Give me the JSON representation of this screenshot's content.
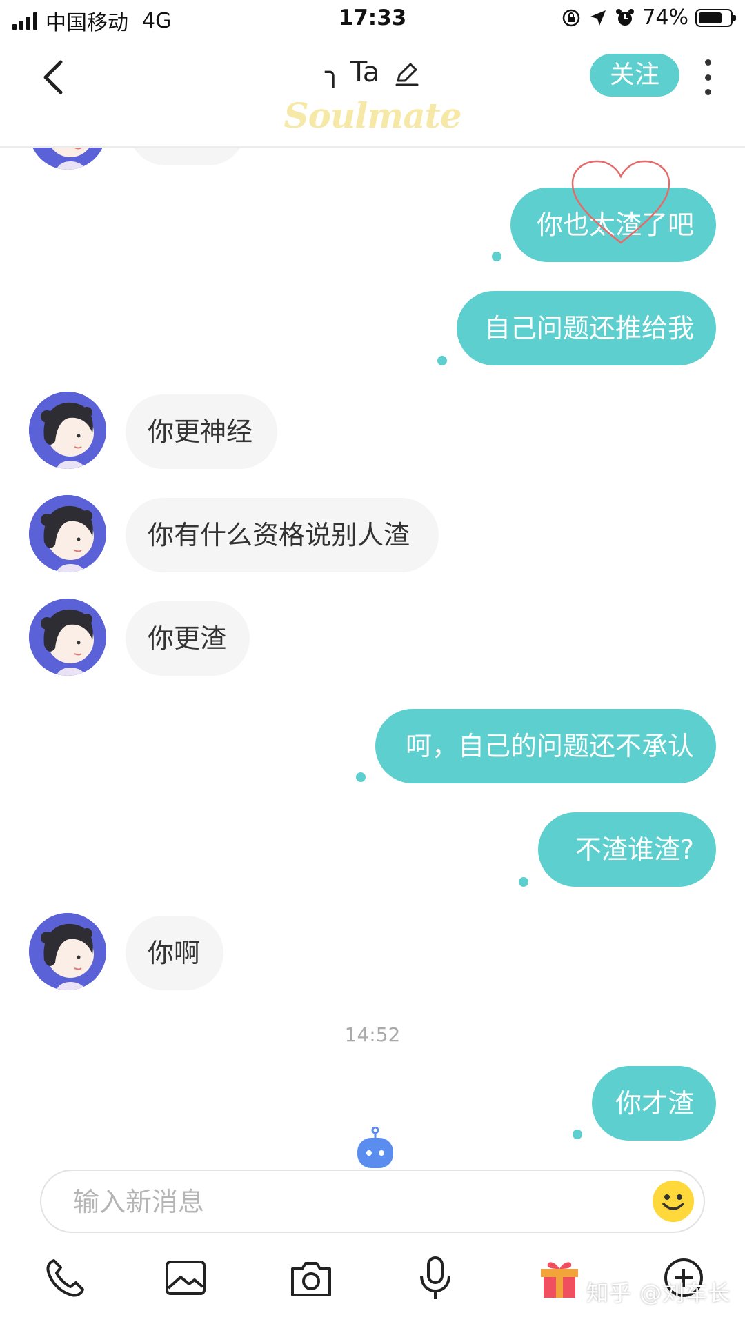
{
  "status_bar": {
    "carrier": "中国移动",
    "network": "4G",
    "time": "17:33",
    "battery_text": "74%",
    "battery_level": 0.74
  },
  "nav": {
    "title": "╮ Ta",
    "brand": "Soulmate",
    "follow_label": "关注"
  },
  "messages": [
    {
      "side": "sent",
      "text": "你也太渣了吧"
    },
    {
      "side": "sent",
      "text": "自己问题还推给我"
    },
    {
      "side": "received",
      "text": "你更神经"
    },
    {
      "side": "received",
      "text": "你有什么资格说别人渣"
    },
    {
      "side": "received",
      "text": "你更渣"
    },
    {
      "side": "sent",
      "text": "呵，自己的问题还不承认"
    },
    {
      "side": "sent",
      "text": "不渣谁渣?"
    },
    {
      "side": "received",
      "text": "你啊"
    },
    {
      "side": "sent",
      "text": "你才渣"
    }
  ],
  "timestamp": "14:52",
  "input": {
    "placeholder": "输入新消息"
  },
  "toolbar": {
    "icons": [
      "phone-icon",
      "image-icon",
      "camera-icon",
      "microphone-icon",
      "gift-icon",
      "plus-icon"
    ]
  },
  "watermark": "知乎 @刘车长",
  "colors": {
    "accent": "#5ecfcf",
    "received_bubble": "#f5f5f5",
    "brand_yellow": "#f3d35a",
    "avatar_bg": "#5b61d6",
    "robot_blue": "#5b8def"
  }
}
